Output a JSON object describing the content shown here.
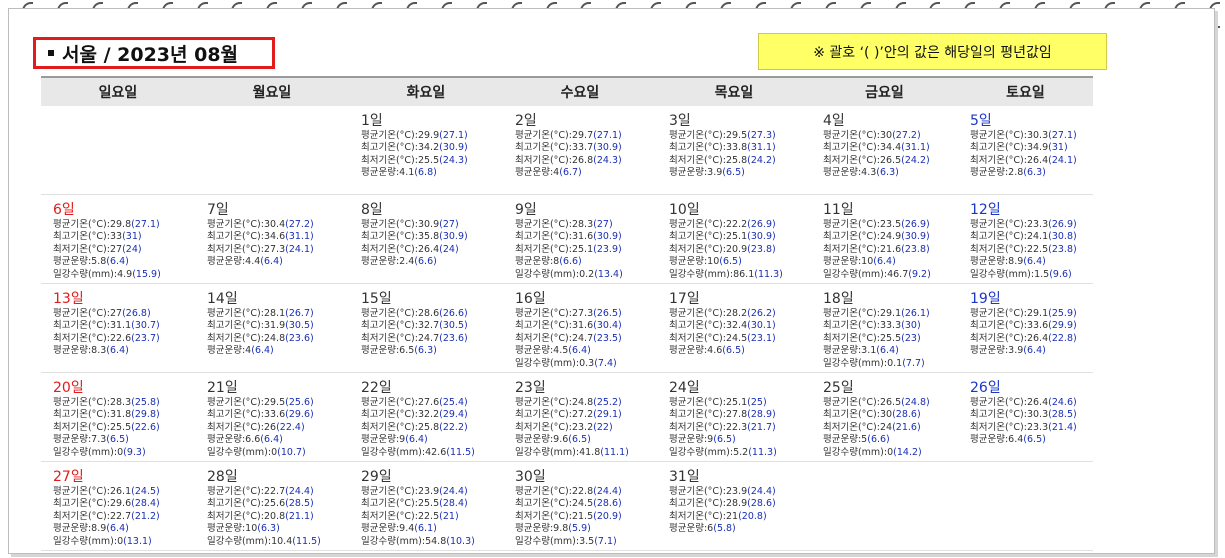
{
  "title": "서울 / 2023년 08월",
  "note": "※ 괄호 ‘( )’안의 값은 해당일의 평년값임",
  "weekdays": [
    "일요일",
    "월요일",
    "화요일",
    "수요일",
    "목요일",
    "금요일",
    "토요일"
  ],
  "labels": {
    "avg": "평균기온(°C):",
    "max": "최고기온(°C):",
    "min": "최저기온(°C):",
    "cloud": "평균운량:",
    "rain": "일강수량(mm):"
  },
  "weeks": [
    [
      null,
      null,
      {
        "day": "1일",
        "avg": [
          "29.9",
          "27.1"
        ],
        "max": [
          "34.2",
          "30.9"
        ],
        "min": [
          "25.5",
          "24.3"
        ],
        "cloud": [
          "4.1",
          "6.8"
        ]
      },
      {
        "day": "2일",
        "avg": [
          "29.7",
          "27.1"
        ],
        "max": [
          "33.7",
          "30.9"
        ],
        "min": [
          "26.8",
          "24.3"
        ],
        "cloud": [
          "4",
          "6.7"
        ]
      },
      {
        "day": "3일",
        "avg": [
          "29.5",
          "27.3"
        ],
        "max": [
          "33.8",
          "31.1"
        ],
        "min": [
          "25.8",
          "24.2"
        ],
        "cloud": [
          "3.9",
          "6.5"
        ]
      },
      {
        "day": "4일",
        "avg": [
          "30",
          "27.2"
        ],
        "max": [
          "34.4",
          "31.1"
        ],
        "min": [
          "26.5",
          "24.2"
        ],
        "cloud": [
          "4.3",
          "6.3"
        ]
      },
      {
        "day": "5일",
        "avg": [
          "30.3",
          "27.1"
        ],
        "max": [
          "34.9",
          "31"
        ],
        "min": [
          "26.4",
          "24.1"
        ],
        "cloud": [
          "2.8",
          "6.3"
        ]
      }
    ],
    [
      {
        "day": "6일",
        "avg": [
          "29.8",
          "27.1"
        ],
        "max": [
          "33",
          "31"
        ],
        "min": [
          "27",
          "24"
        ],
        "cloud": [
          "5.8",
          "6.4"
        ],
        "rain": [
          "4.9",
          "15.9"
        ]
      },
      {
        "day": "7일",
        "avg": [
          "30.4",
          "27.2"
        ],
        "max": [
          "34.6",
          "31.1"
        ],
        "min": [
          "27.3",
          "24.1"
        ],
        "cloud": [
          "4.4",
          "6.4"
        ]
      },
      {
        "day": "8일",
        "avg": [
          "30.9",
          "27"
        ],
        "max": [
          "35.8",
          "30.9"
        ],
        "min": [
          "26.4",
          "24"
        ],
        "cloud": [
          "2.4",
          "6.6"
        ]
      },
      {
        "day": "9일",
        "avg": [
          "28.3",
          "27"
        ],
        "max": [
          "31.6",
          "30.9"
        ],
        "min": [
          "25.1",
          "23.9"
        ],
        "cloud": [
          "8",
          "6.6"
        ],
        "rain": [
          "0.2",
          "13.4"
        ]
      },
      {
        "day": "10일",
        "avg": [
          "22.2",
          "26.9"
        ],
        "max": [
          "25.1",
          "30.9"
        ],
        "min": [
          "20.9",
          "23.8"
        ],
        "cloud": [
          "10",
          "6.5"
        ],
        "rain": [
          "86.1",
          "11.3"
        ]
      },
      {
        "day": "11일",
        "avg": [
          "23.5",
          "26.9"
        ],
        "max": [
          "24.9",
          "30.9"
        ],
        "min": [
          "21.6",
          "23.8"
        ],
        "cloud": [
          "10",
          "6.4"
        ],
        "rain": [
          "46.7",
          "9.2"
        ]
      },
      {
        "day": "12일",
        "avg": [
          "23.3",
          "26.9"
        ],
        "max": [
          "24.1",
          "30.8"
        ],
        "min": [
          "22.5",
          "23.8"
        ],
        "cloud": [
          "8.9",
          "6.4"
        ],
        "rain": [
          "1.5",
          "9.6"
        ]
      }
    ],
    [
      {
        "day": "13일",
        "avg": [
          "27",
          "26.8"
        ],
        "max": [
          "31.1",
          "30.7"
        ],
        "min": [
          "22.6",
          "23.7"
        ],
        "cloud": [
          "8.3",
          "6.4"
        ]
      },
      {
        "day": "14일",
        "avg": [
          "28.1",
          "26.7"
        ],
        "max": [
          "31.9",
          "30.5"
        ],
        "min": [
          "24.8",
          "23.6"
        ],
        "cloud": [
          "4",
          "6.4"
        ]
      },
      {
        "day": "15일",
        "avg": [
          "28.6",
          "26.6"
        ],
        "max": [
          "32.7",
          "30.5"
        ],
        "min": [
          "24.7",
          "23.6"
        ],
        "cloud": [
          "6.5",
          "6.3"
        ]
      },
      {
        "day": "16일",
        "avg": [
          "27.3",
          "26.5"
        ],
        "max": [
          "31.6",
          "30.4"
        ],
        "min": [
          "24.7",
          "23.5"
        ],
        "cloud": [
          "4.5",
          "6.4"
        ],
        "rain": [
          "0.3",
          "7.4"
        ]
      },
      {
        "day": "17일",
        "avg": [
          "28.2",
          "26.2"
        ],
        "max": [
          "32.4",
          "30.1"
        ],
        "min": [
          "24.5",
          "23.1"
        ],
        "cloud": [
          "4.6",
          "6.5"
        ]
      },
      {
        "day": "18일",
        "avg": [
          "29.1",
          "26.1"
        ],
        "max": [
          "33.3",
          "30"
        ],
        "min": [
          "25.5",
          "23"
        ],
        "cloud": [
          "3.1",
          "6.4"
        ],
        "rain": [
          "0.1",
          "7.7"
        ]
      },
      {
        "day": "19일",
        "avg": [
          "29.1",
          "25.9"
        ],
        "max": [
          "33.6",
          "29.9"
        ],
        "min": [
          "26.4",
          "22.8"
        ],
        "cloud": [
          "3.9",
          "6.4"
        ]
      }
    ],
    [
      {
        "day": "20일",
        "avg": [
          "28.3",
          "25.8"
        ],
        "max": [
          "31.8",
          "29.8"
        ],
        "min": [
          "25.5",
          "22.6"
        ],
        "cloud": [
          "7.3",
          "6.5"
        ],
        "rain": [
          "0",
          "9.3"
        ]
      },
      {
        "day": "21일",
        "avg": [
          "29.5",
          "25.6"
        ],
        "max": [
          "33.6",
          "29.6"
        ],
        "min": [
          "26",
          "22.4"
        ],
        "cloud": [
          "6.6",
          "6.4"
        ],
        "rain": [
          "0",
          "10.7"
        ]
      },
      {
        "day": "22일",
        "avg": [
          "27.6",
          "25.4"
        ],
        "max": [
          "32.2",
          "29.4"
        ],
        "min": [
          "25.8",
          "22.2"
        ],
        "cloud": [
          "9",
          "6.4"
        ],
        "rain": [
          "42.6",
          "11.5"
        ]
      },
      {
        "day": "23일",
        "avg": [
          "24.8",
          "25.2"
        ],
        "max": [
          "27.2",
          "29.1"
        ],
        "min": [
          "23.2",
          "22"
        ],
        "cloud": [
          "9.6",
          "6.5"
        ],
        "rain": [
          "41.8",
          "11.1"
        ]
      },
      {
        "day": "24일",
        "avg": [
          "25.1",
          "25"
        ],
        "max": [
          "27.8",
          "28.9"
        ],
        "min": [
          "22.3",
          "21.7"
        ],
        "cloud": [
          "9",
          "6.5"
        ],
        "rain": [
          "5.2",
          "11.3"
        ]
      },
      {
        "day": "25일",
        "avg": [
          "26.5",
          "24.8"
        ],
        "max": [
          "30",
          "28.6"
        ],
        "min": [
          "24",
          "21.6"
        ],
        "cloud": [
          "5",
          "6.6"
        ],
        "rain": [
          "0",
          "14.2"
        ]
      },
      {
        "day": "26일",
        "avg": [
          "26.4",
          "24.6"
        ],
        "max": [
          "30.3",
          "28.5"
        ],
        "min": [
          "23.3",
          "21.4"
        ],
        "cloud": [
          "6.4",
          "6.5"
        ]
      }
    ],
    [
      {
        "day": "27일",
        "avg": [
          "26.1",
          "24.5"
        ],
        "max": [
          "29.6",
          "28.4"
        ],
        "min": [
          "22.7",
          "21.2"
        ],
        "cloud": [
          "8.9",
          "6.4"
        ],
        "rain": [
          "0",
          "13.1"
        ]
      },
      {
        "day": "28일",
        "avg": [
          "22.7",
          "24.4"
        ],
        "max": [
          "25.6",
          "28.5"
        ],
        "min": [
          "20.8",
          "21.1"
        ],
        "cloud": [
          "10",
          "6.3"
        ],
        "rain": [
          "10.4",
          "11.5"
        ]
      },
      {
        "day": "29일",
        "avg": [
          "23.9",
          "24.4"
        ],
        "max": [
          "25.5",
          "28.4"
        ],
        "min": [
          "22.5",
          "21"
        ],
        "cloud": [
          "9.4",
          "6.1"
        ],
        "rain": [
          "54.8",
          "10.3"
        ]
      },
      {
        "day": "30일",
        "avg": [
          "22.8",
          "24.4"
        ],
        "max": [
          "24.5",
          "28.6"
        ],
        "min": [
          "21.5",
          "20.9"
        ],
        "cloud": [
          "9.8",
          "5.9"
        ],
        "rain": [
          "3.5",
          "7.1"
        ]
      },
      {
        "day": "31일",
        "avg": [
          "23.9",
          "24.4"
        ],
        "max": [
          "28.9",
          "28.6"
        ],
        "min": [
          "21",
          "20.8"
        ],
        "cloud": [
          "6",
          "5.8"
        ]
      },
      null,
      null
    ]
  ]
}
